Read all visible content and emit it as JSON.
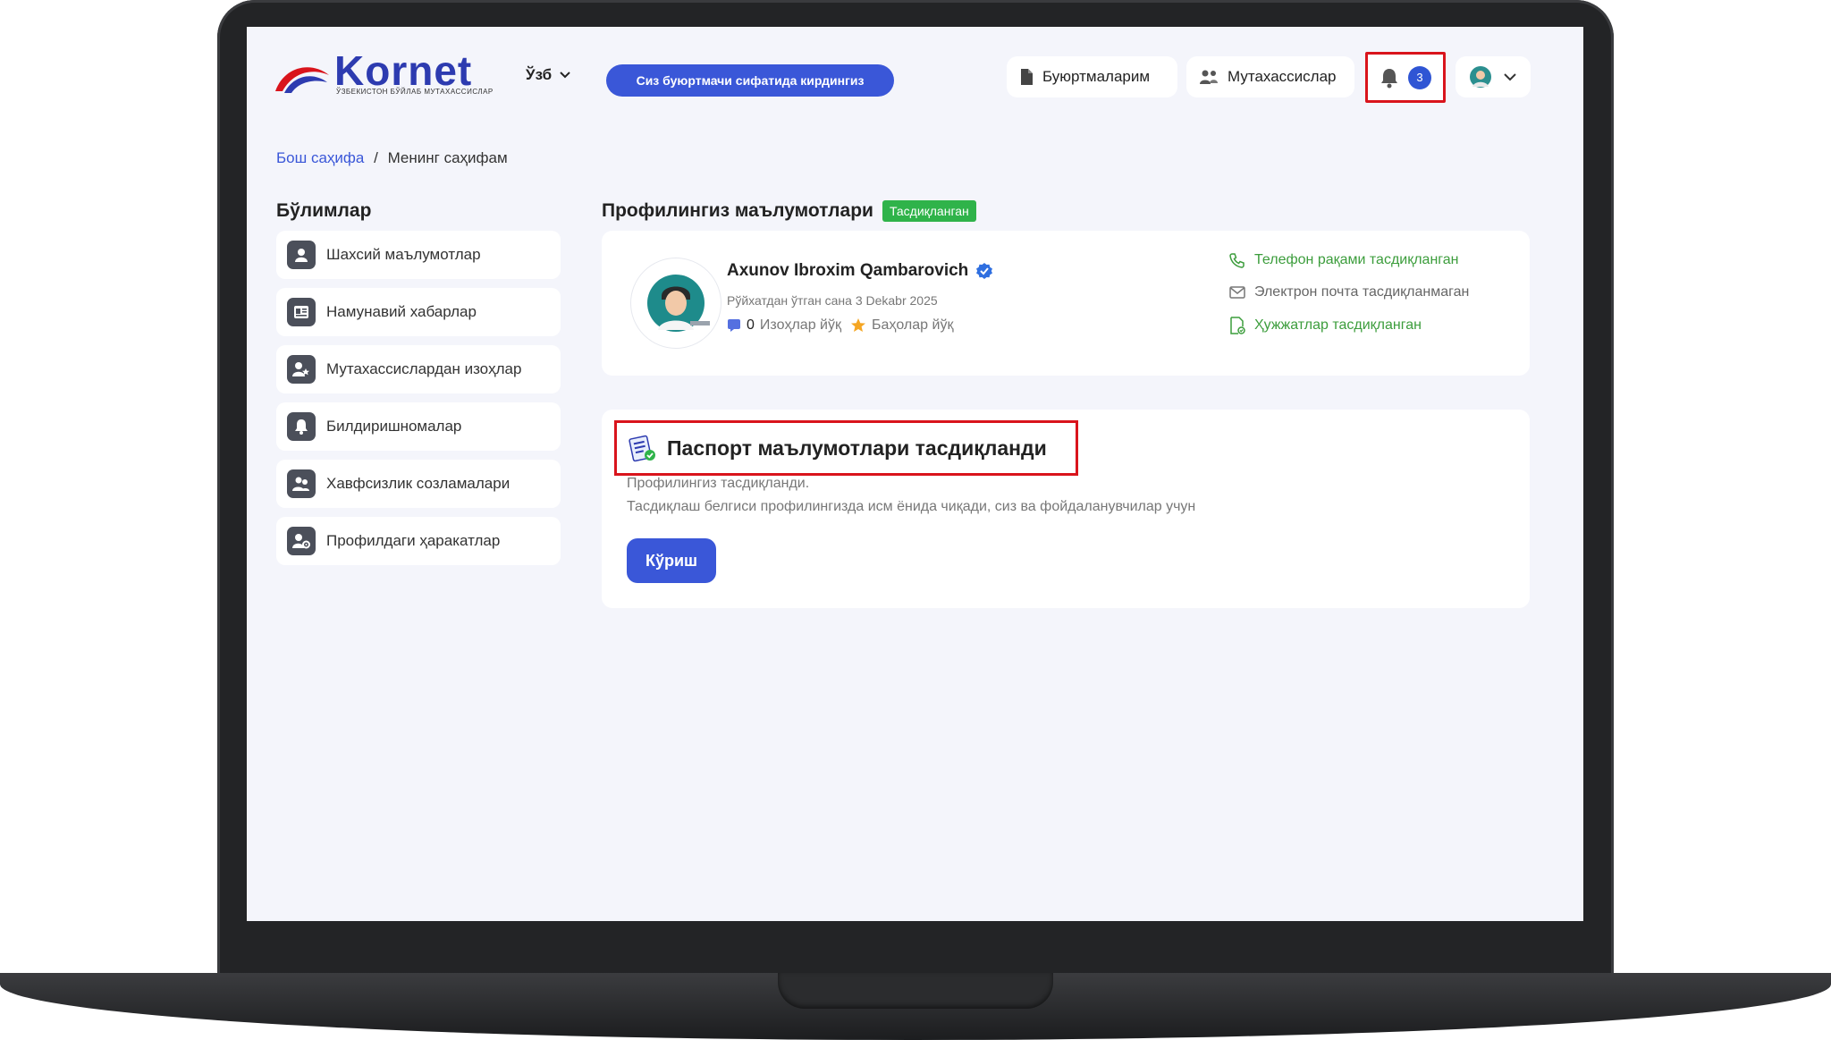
{
  "header": {
    "logo_text": "Kornet",
    "logo_subtitle": "ЎЗБЕКИСТОН БЎЙЛАБ МУТАХАССИСЛАР",
    "language": "Ўзб",
    "role_button": "Сиз буюртмачи сифатида кирдингиз",
    "orders_button": "Буюртмаларим",
    "specialists_button": "Мутахассислар",
    "notification_count": "3"
  },
  "breadcrumb": {
    "home": "Бош саҳифа",
    "separator": "/",
    "current": "Менинг саҳифам"
  },
  "sidebar": {
    "title": "Бўлимлар",
    "items": [
      {
        "label": "Шахсий маълумотлар",
        "icon": "user-icon"
      },
      {
        "label": "Намунавий хабарлар",
        "icon": "message-template-icon"
      },
      {
        "label": "Мутахассислардан изоҳлар",
        "icon": "user-star-icon"
      },
      {
        "label": "Билдиришномалар",
        "icon": "bell-icon"
      },
      {
        "label": "Хавфсизлик созламалари",
        "icon": "users-shield-icon"
      },
      {
        "label": "Профилдаги ҳаракатлар",
        "icon": "user-gear-icon"
      }
    ]
  },
  "profile": {
    "section_title": "Профилингиз маълумотлари",
    "status_badge": "Тасдиқланган",
    "name": "Axunov Ibroxim Qambarovich",
    "registered": "Рўйхатдан ўтган сана 3 Dekabr 2025",
    "comments_count": "0",
    "comments_label": "Изоҳлар йўқ",
    "ratings_label": "Баҳолар йўқ",
    "phone_status": "Телефон рақами тасдиқланган",
    "email_status": "Электрон почта тасдиқланмаган",
    "docs_status": "Ҳужжатлар тасдиқланган"
  },
  "passport": {
    "title": "Паспорт маълумотлари тасдиқланди",
    "line1": "Профилингиз тасдиқланди.",
    "line2": "Тасдиқлаш белгиси профилингизда исм ёнида чиқади, сиз ва фойдаланувчилар учун",
    "view_button": "Кўриш"
  },
  "colors": {
    "accent": "#3a57d8",
    "success": "#2fb34a",
    "highlight": "#d9141c",
    "background": "#f4f5fb"
  }
}
